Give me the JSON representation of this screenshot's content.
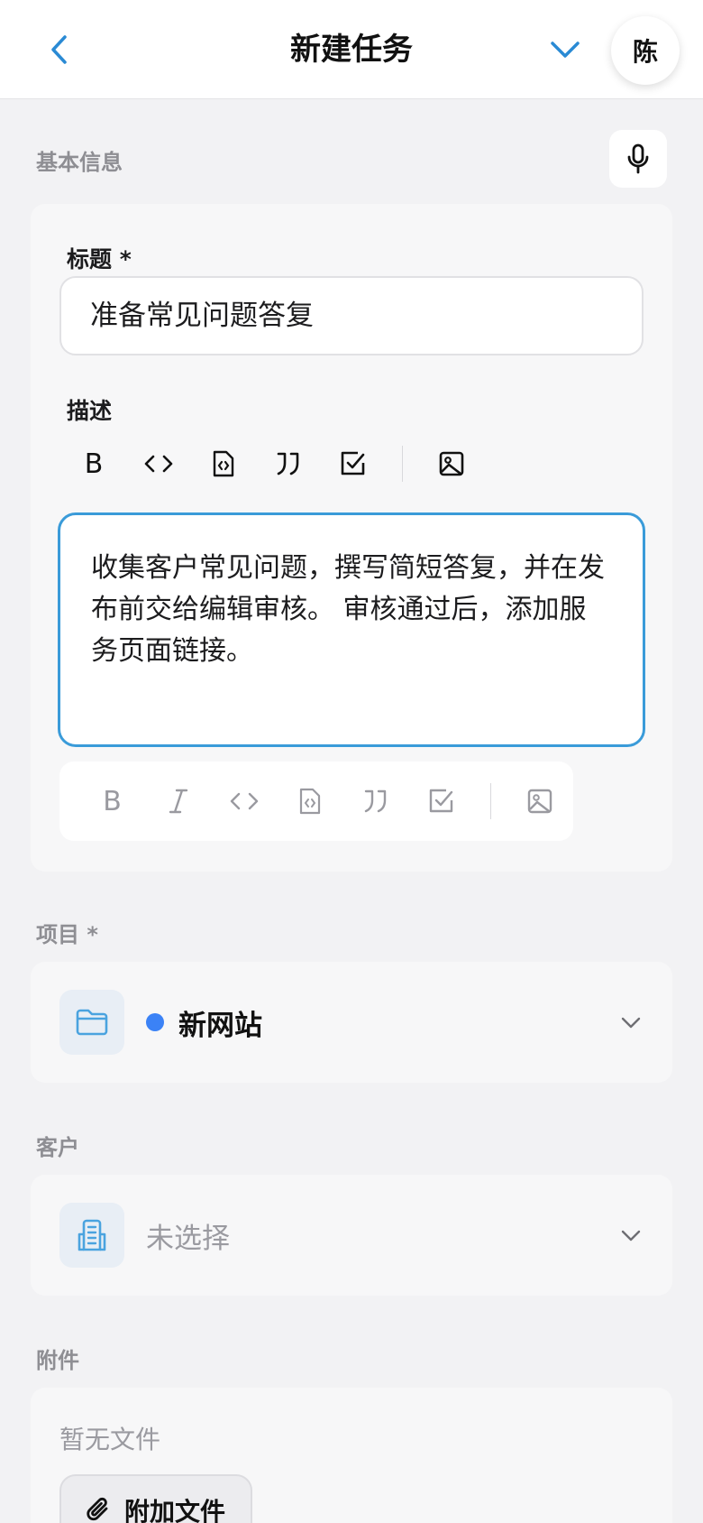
{
  "header": {
    "title": "新建任务",
    "avatar_initial": "陈"
  },
  "basic_info": {
    "section_label": "基本信息",
    "title_label": "标题 *",
    "title_value": "准备常见问题答复",
    "description_label": "描述",
    "description_value": "收集客户常见问题，撰写简短答复，并在发布前交给编辑审核。 审核通过后，添加服务页面链接。",
    "toolbar_bold_glyph": "B"
  },
  "project": {
    "section_label": "项目 *",
    "selected": "新网站",
    "dot_color": "#3b82f6"
  },
  "client": {
    "section_label": "客户",
    "selected": "未选择"
  },
  "attachments": {
    "section_label": "附件",
    "empty_text": "暂无文件",
    "attach_button": "附加文件"
  },
  "icons": [
    "back-icon",
    "chevron-down-icon",
    "microphone-icon",
    "bold-icon",
    "italic-icon",
    "code-icon",
    "code-file-icon",
    "quote-icon",
    "checkbox-icon",
    "image-icon",
    "folder-icon",
    "building-icon",
    "paperclip-icon"
  ],
  "colors": {
    "accent": "#2a8ad4",
    "focus_border": "#3a9bd9",
    "icon_tint": "#4aa3df"
  }
}
